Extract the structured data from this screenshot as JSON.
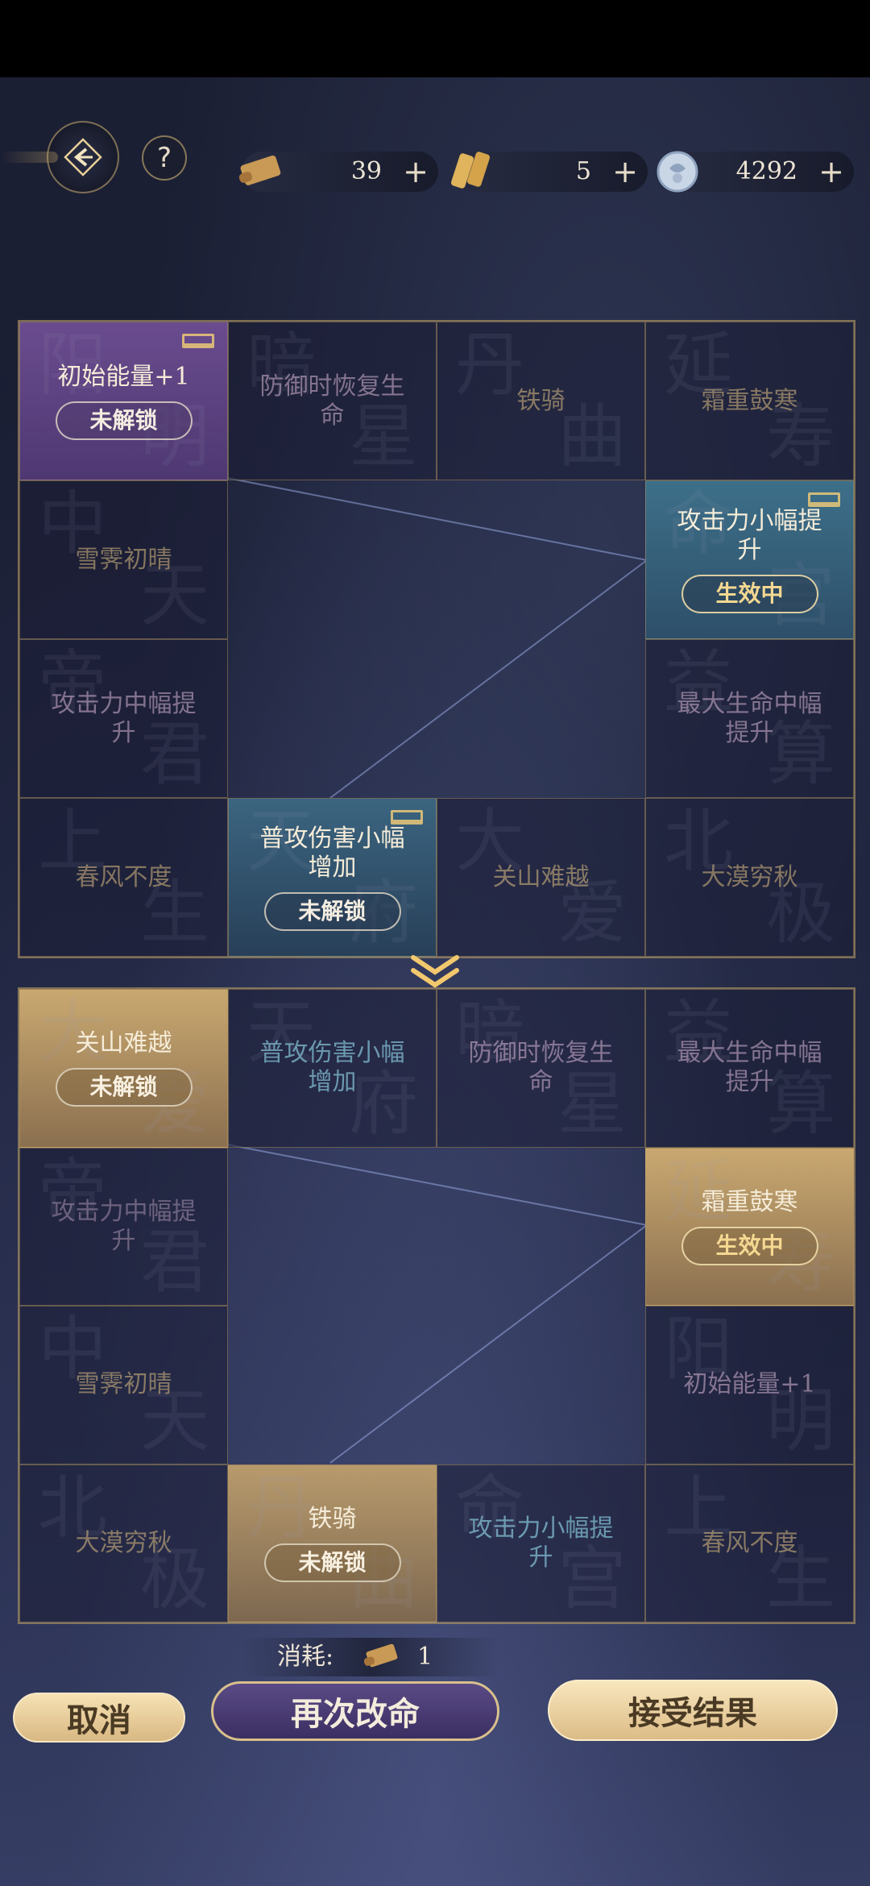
{
  "resources": [
    {
      "name": "scroll-icon",
      "value": "39",
      "plus": "+"
    },
    {
      "name": "tablet-icon",
      "value": "5",
      "plus": "+"
    },
    {
      "name": "jade-coin-icon",
      "value": "4292",
      "plus": "+"
    }
  ],
  "help_label": "?",
  "grid1": {
    "r1c1": {
      "label": "初始能量+1",
      "badge": "未解锁",
      "wm1": "阳",
      "wm2": "明"
    },
    "r1c2": {
      "label": "防御时恢复生命",
      "wm1": "暗",
      "wm2": "星"
    },
    "r1c3": {
      "label": "铁骑",
      "wm1": "丹",
      "wm2": "曲"
    },
    "r1c4": {
      "label": "霜重鼓寒",
      "wm1": "延",
      "wm2": "寿"
    },
    "r2c1": {
      "label": "雪霁初晴",
      "wm1": "中",
      "wm2": "天"
    },
    "r2c4": {
      "label": "攻击力小幅提升",
      "badge": "生效中",
      "wm1": "命",
      "wm2": "宫"
    },
    "r3c1": {
      "label": "攻击力中幅提升",
      "wm1": "帝",
      "wm2": "君"
    },
    "r3c4": {
      "label": "最大生命中幅提升",
      "wm1": "益",
      "wm2": "算"
    },
    "r4c1": {
      "label": "春风不度",
      "wm1": "上",
      "wm2": "生"
    },
    "r4c2": {
      "label": "普攻伤害小幅增加",
      "badge": "未解锁",
      "wm1": "天",
      "wm2": "府"
    },
    "r4c3": {
      "label": "关山难越",
      "wm1": "大",
      "wm2": "爱"
    },
    "r4c4": {
      "label": "大漠穷秋",
      "wm1": "北",
      "wm2": "极"
    }
  },
  "grid2": {
    "r1c1": {
      "label": "关山难越",
      "badge": "未解锁",
      "wm1": "大",
      "wm2": "爱"
    },
    "r1c2": {
      "label": "普攻伤害小幅增加",
      "wm1": "天",
      "wm2": "府"
    },
    "r1c3": {
      "label": "防御时恢复生命",
      "wm1": "暗",
      "wm2": "星"
    },
    "r1c4": {
      "label": "最大生命中幅提升",
      "wm1": "益",
      "wm2": "算"
    },
    "r2c1": {
      "label": "攻击力中幅提升",
      "wm1": "帝",
      "wm2": "君"
    },
    "r2c4": {
      "label": "霜重鼓寒",
      "badge": "生效中",
      "wm1": "延",
      "wm2": "寿"
    },
    "r3c1": {
      "label": "雪霁初晴",
      "wm1": "中",
      "wm2": "天"
    },
    "r3c4": {
      "label": "初始能量+1",
      "wm1": "阳",
      "wm2": "明"
    },
    "r4c1": {
      "label": "大漠穷秋",
      "wm1": "北",
      "wm2": "极"
    },
    "r4c2": {
      "label": "铁骑",
      "badge": "未解锁",
      "wm1": "丹",
      "wm2": "曲"
    },
    "r4c3": {
      "label": "攻击力小幅提升",
      "wm1": "命",
      "wm2": "宫"
    },
    "r4c4": {
      "label": "春风不度",
      "wm1": "上",
      "wm2": "生"
    }
  },
  "cost": {
    "label": "消耗:",
    "amount": "1"
  },
  "buttons": {
    "cancel": "取消",
    "reroll": "再次改命",
    "accept": "接受结果"
  },
  "colors": {
    "gold_border": "#bea064",
    "purple_cell": "#6a4c8e",
    "teal_cell": "#3d6f89",
    "gold_cell": "#c9a870"
  }
}
